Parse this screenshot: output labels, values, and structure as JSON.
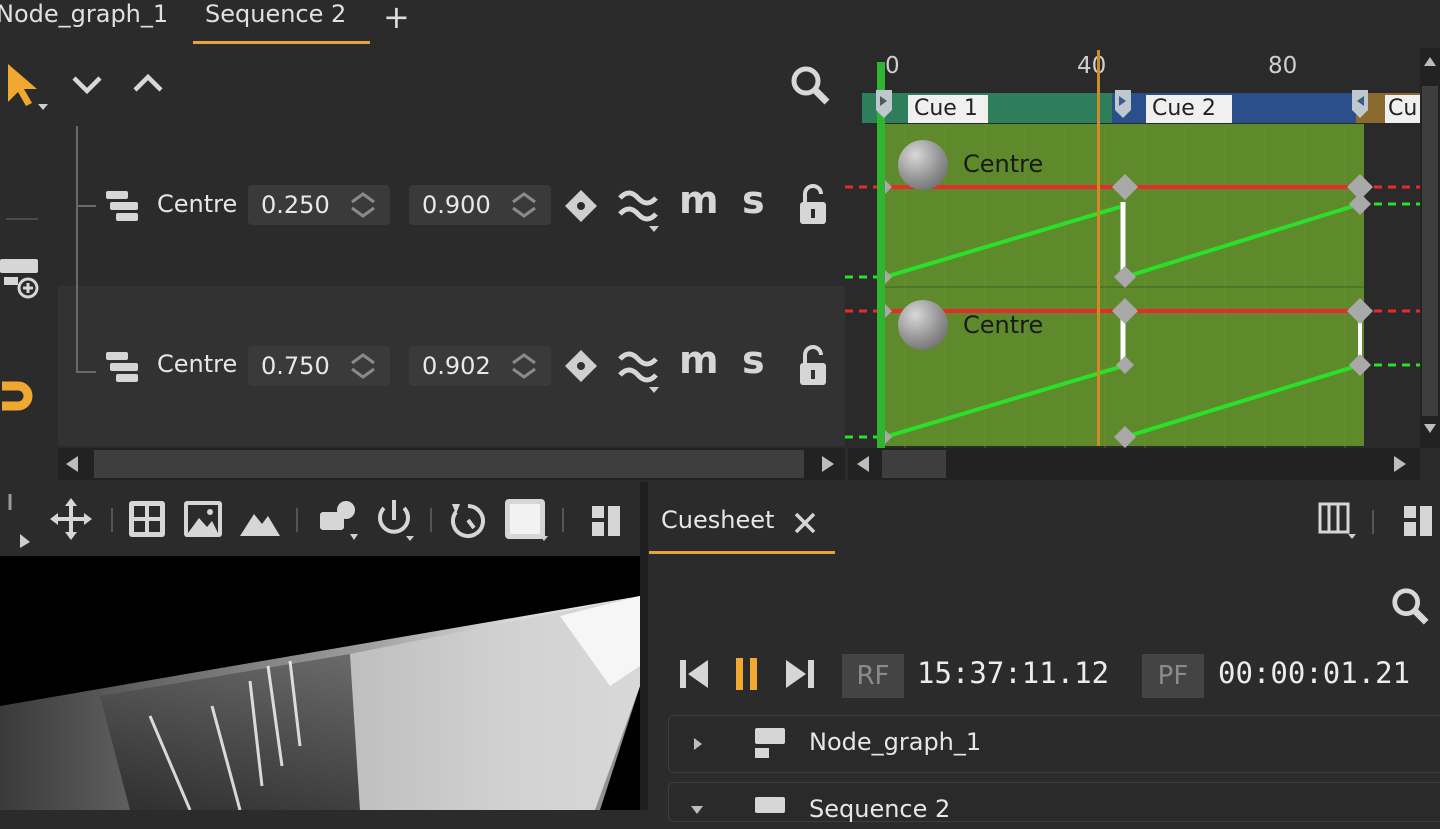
{
  "tabs": [
    {
      "label": "Node_graph_1"
    },
    {
      "label": "Sequence 2",
      "active": true
    }
  ],
  "add_tab_glyph": "+",
  "tracks": [
    {
      "label": "Centre",
      "value1": "0.250",
      "value2": "0.900"
    },
    {
      "label": "Centre",
      "value1": "0.750",
      "value2": "0.902"
    }
  ],
  "track_buttons": {
    "mute": "m",
    "solo": "s"
  },
  "timeline": {
    "ruler_ticks": [
      "0",
      "40",
      "80"
    ],
    "cues": [
      {
        "label": "Cue 1",
        "color": "#2e7d5b"
      },
      {
        "label": "Cue 2",
        "color": "#2a4f8a"
      },
      {
        "label": "Cu",
        "color": "#8a6a2e"
      }
    ],
    "lane_labels": [
      "Centre",
      "Centre"
    ],
    "region_color": "#5f8a2c",
    "playhead_color": "#2fb52f",
    "marker_color": "#d08a28"
  },
  "cuesheet": {
    "title": "Cuesheet",
    "rf_label": "RF",
    "rf_time": "15:37:11.12",
    "pf_label": "PF",
    "pf_time": "00:00:01.21",
    "items": [
      {
        "label": "Node_graph_1"
      },
      {
        "label": "Sequence 2"
      }
    ]
  },
  "colors": {
    "accent": "#e8a33d",
    "background": "#2b2b2b",
    "curve_red": "#e52b2b",
    "curve_green": "#2ae02a"
  }
}
